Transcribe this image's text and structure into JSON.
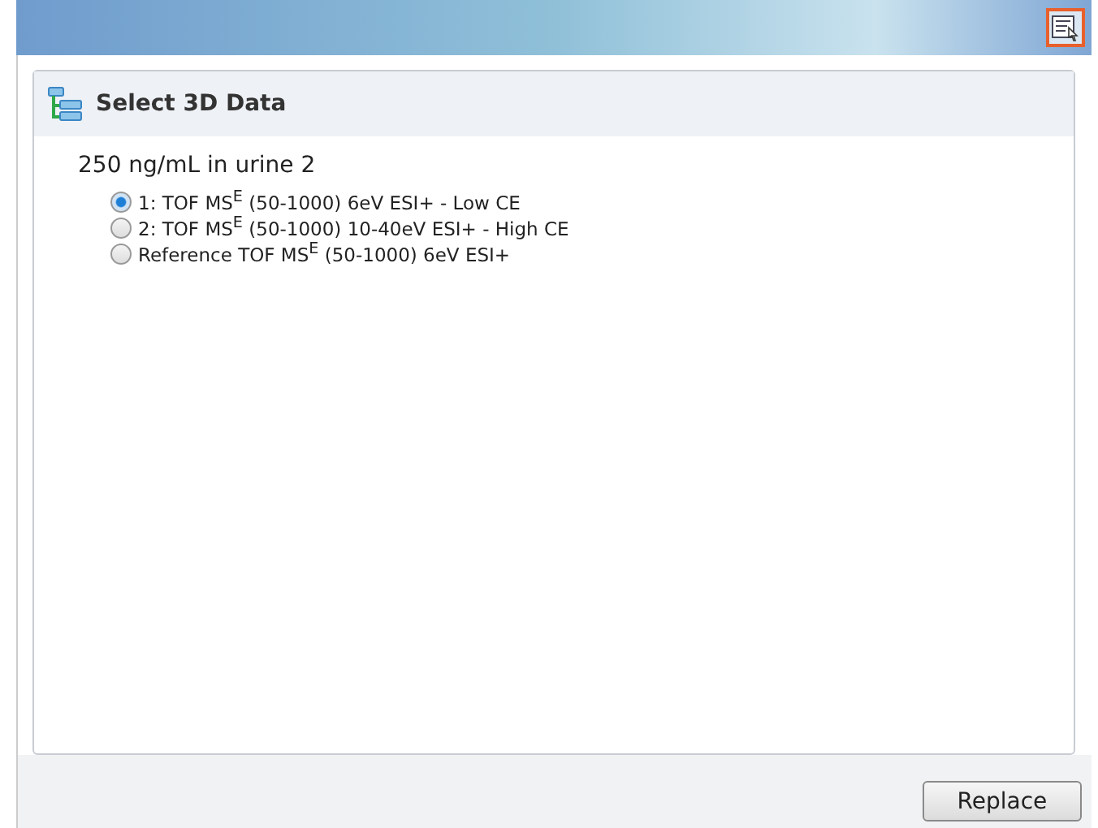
{
  "panel": {
    "title": "Select 3D Data",
    "sample": "250 ng/mL in urine 2"
  },
  "options": [
    {
      "label": "1: TOF MS$^{E}$ (50-1000) 6eV ESI+ - Low CE",
      "selected": true
    },
    {
      "label": "2: TOF MS$^{E}$ (50-1000) 10-40eV ESI+ - High CE",
      "selected": false
    },
    {
      "label": "Reference TOF MS$^{E}$ (50-1000) 6eV ESI+",
      "selected": false
    }
  ],
  "buttons": [
    "Replace"
  ]
}
